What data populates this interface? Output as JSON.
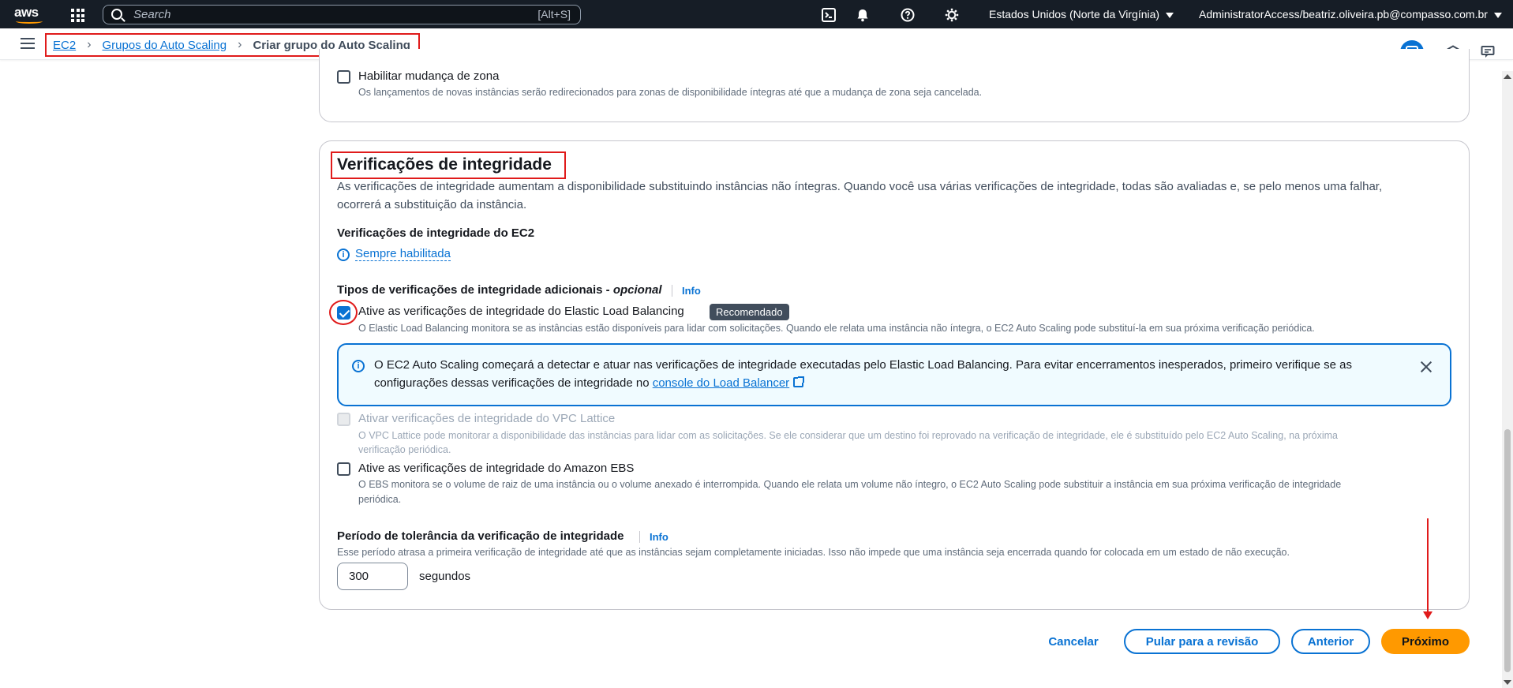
{
  "topnav": {
    "logo_text": "aws",
    "search_placeholder": "Search",
    "search_shortcut": "[Alt+S]",
    "region": "Estados Unidos (Norte da Virgínia)",
    "account": "AdministratorAccess/beatriz.oliveira.pb@compasso.com.br",
    "icons": [
      "cloudshell-icon",
      "bell-icon",
      "help-icon",
      "gear-icon"
    ]
  },
  "breadcrumb": {
    "items": [
      "EC2",
      "Grupos do Auto Scaling",
      "Criar grupo do Auto Scaling"
    ]
  },
  "zone_shift": {
    "checkbox_label": "Habilitar mudança de zona",
    "description": "Os lançamentos de novas instâncias serão redirecionados para zonas de disponibilidade íntegras até que a mudança de zona seja cancelada.",
    "checked": false
  },
  "health": {
    "title": "Verificações de integridade",
    "description_line1": "As verificações de integridade aumentam a disponibilidade substituindo instâncias não íntegras. Quando você usa várias verificações de integridade, todas são avaliadas e, se pelo menos uma falhar,",
    "description_line2": "ocorrerá a substituição da instância.",
    "ec2_label": "Verificações de integridade do EC2",
    "ec2_status": "Sempre habilitada",
    "additional_label": "Tipos de verificações de integridade adicionais - ",
    "additional_optional": "opcional",
    "info": "Info",
    "elb": {
      "label": "Ative as verificações de integridade do Elastic Load Balancing",
      "badge": "Recomendado",
      "description": "O Elastic Load Balancing monitora se as instâncias estão disponíveis para lidar com solicitações. Quando ele relata uma instância não íntegra, o EC2 Auto Scaling pode substituí-la em sua próxima verificação periódica.",
      "checked": true
    },
    "alert": {
      "line1": "O EC2 Auto Scaling começará a detectar e atuar nas verificações de integridade executadas pelo Elastic Load Balancing. Para evitar encerramentos inesperados, primeiro verifique se as",
      "line2_prefix": "configurações dessas verificações de integridade no ",
      "link": "console do Load Balancer"
    },
    "vpc": {
      "label": "Ativar verificações de integridade do VPC Lattice",
      "description_line1": "O VPC Lattice pode monitorar a disponibilidade das instâncias para lidar com as solicitações. Se ele considerar que um destino foi reprovado na verificação de integridade, ele é substituído pelo EC2 Auto Scaling, na próxima",
      "description_line2": "verificação periódica.",
      "disabled": true
    },
    "ebs": {
      "label": "Ative as verificações de integridade do Amazon EBS",
      "description_line1": "O EBS monitora se o volume de raiz de uma instância ou o volume anexado é interrompida. Quando ele relata um volume não íntegro, o EC2 Auto Scaling pode substituir a instância em sua próxima verificação de integridade",
      "description_line2": "periódica.",
      "checked": false
    },
    "grace": {
      "label": "Período de tolerância da verificação de integridade",
      "info": "Info",
      "description": "Esse período atrasa a primeira verificação de integridade até que as instâncias sejam completamente iniciadas. Isso não impede que uma instância seja encerrada quando for colocada em um estado de não execução.",
      "value": "300",
      "unit": "segundos"
    }
  },
  "footer": {
    "cancel": "Cancelar",
    "skip": "Pular para a revisão",
    "previous": "Anterior",
    "next": "Próximo"
  },
  "colors": {
    "nav_bg": "#161d26",
    "accent": "#0972d3",
    "primary_button": "#ff9900",
    "annotation_red": "#e01b1b"
  }
}
